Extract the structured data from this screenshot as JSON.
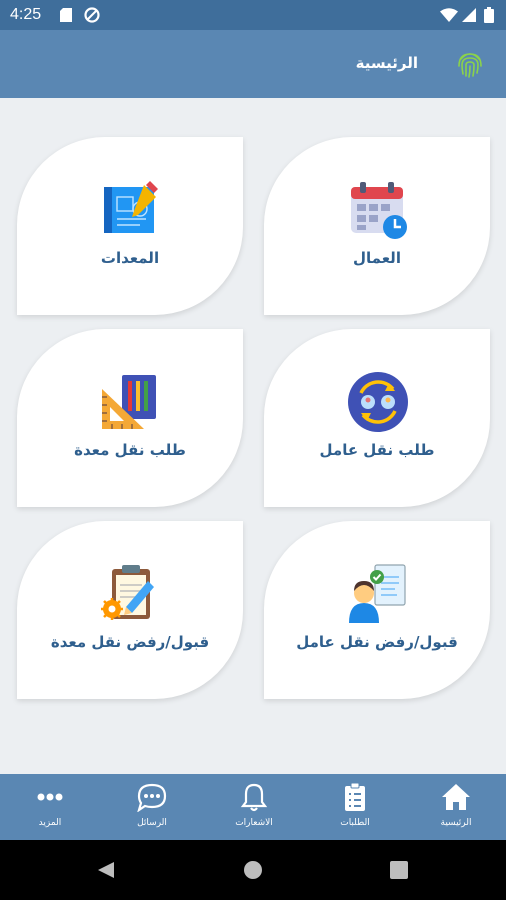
{
  "status": {
    "time": "4:25"
  },
  "header": {
    "title": "الرئيسية"
  },
  "cards": [
    {
      "label": "العمال",
      "icon": "calendar-clock-icon"
    },
    {
      "label": "المعدات",
      "icon": "blueprint-icon"
    },
    {
      "label": "طلب نقل عامل",
      "icon": "worker-transfer-icon"
    },
    {
      "label": "طلب نقل معدة",
      "icon": "tools-ruler-icon"
    },
    {
      "label": "قبول/رفض نقل عامل",
      "icon": "approval-person-icon"
    },
    {
      "label": "قبول/رفض  نقل معدة",
      "icon": "clipboard-gear-icon"
    }
  ],
  "nav": [
    {
      "label": "الرئيسية",
      "icon": "home-icon"
    },
    {
      "label": "الطلبات",
      "icon": "clipboard-list-icon"
    },
    {
      "label": "الاشعارات",
      "icon": "bell-icon"
    },
    {
      "label": "الرسائل",
      "icon": "chat-icon"
    },
    {
      "label": "المزيد",
      "icon": "more-icon"
    }
  ],
  "colors": {
    "status": "#3f6e9b",
    "appbar": "#5a87b3",
    "label": "#2f5f8e",
    "bg": "#eceff2"
  }
}
